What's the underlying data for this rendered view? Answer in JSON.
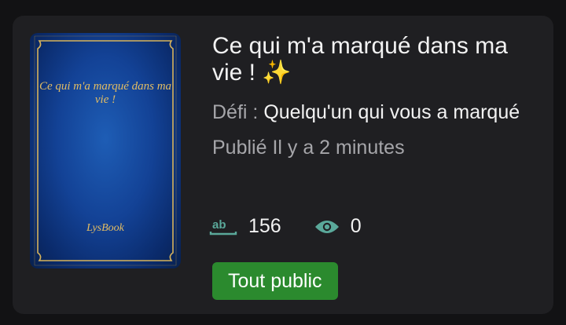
{
  "story": {
    "title": "Ce qui m'a marqué dans ma vie ! ✨",
    "cover": {
      "title": "Ce qui m'a marqué dans ma vie !",
      "author": "LysBook"
    },
    "challenge": {
      "label": "Défi :",
      "value": "Quelqu'un qui vous a marqué"
    },
    "published": "Publié Il y a 2 minutes",
    "stats": {
      "words_icon": "word-count-icon",
      "words": "156",
      "views_icon": "eye-icon",
      "views": "0"
    },
    "rating": "Tout public"
  },
  "colors": {
    "card_bg": "#1f1f22",
    "page_bg": "#121214",
    "badge_green": "#2b8a2e",
    "icon_teal": "#5aa89a",
    "cover_gold": "#e3bd63",
    "cover_blue": "#134296"
  }
}
